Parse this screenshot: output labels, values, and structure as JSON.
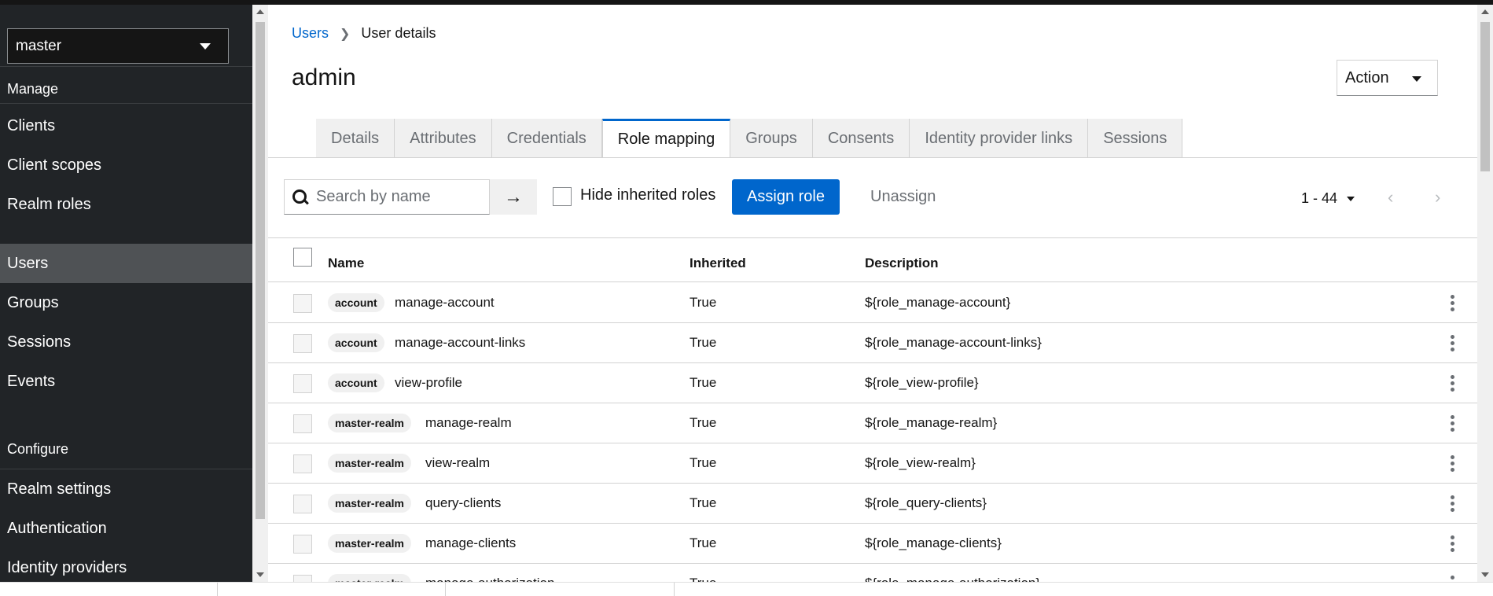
{
  "sidebar": {
    "realm": "master",
    "sections": [
      {
        "title": "Manage",
        "items": [
          "Clients",
          "Client scopes",
          "Realm roles",
          "Users",
          "Groups",
          "Sessions",
          "Events"
        ]
      },
      {
        "title": "Configure",
        "items": [
          "Realm settings",
          "Authentication",
          "Identity providers"
        ]
      }
    ]
  },
  "breadcrumb": {
    "parent": "Users",
    "current": "User details"
  },
  "page": {
    "title": "admin",
    "action_label": "Action"
  },
  "tabs": [
    "Details",
    "Attributes",
    "Credentials",
    "Role mapping",
    "Groups",
    "Consents",
    "Identity provider links",
    "Sessions"
  ],
  "toolbar": {
    "search_placeholder": "Search by name",
    "hide_inherited_label": "Hide inherited roles",
    "assign_label": "Assign role",
    "unassign_label": "Unassign",
    "pagination": "1 - 44"
  },
  "table": {
    "headers": {
      "name": "Name",
      "inherited": "Inherited",
      "description": "Description"
    },
    "rows": [
      {
        "client": "account",
        "role": "manage-account",
        "inherited": "True",
        "description": "${role_manage-account}"
      },
      {
        "client": "account",
        "role": "manage-account-links",
        "inherited": "True",
        "description": "${role_manage-account-links}"
      },
      {
        "client": "account",
        "role": "view-profile",
        "inherited": "True",
        "description": "${role_view-profile}"
      },
      {
        "client": "master-realm",
        "role": "manage-realm",
        "inherited": "True",
        "description": "${role_manage-realm}"
      },
      {
        "client": "master-realm",
        "role": "view-realm",
        "inherited": "True",
        "description": "${role_view-realm}"
      },
      {
        "client": "master-realm",
        "role": "query-clients",
        "inherited": "True",
        "description": "${role_query-clients}"
      },
      {
        "client": "master-realm",
        "role": "manage-clients",
        "inherited": "True",
        "description": "${role_manage-clients}"
      },
      {
        "client": "master-realm",
        "role": "manage-authorization",
        "inherited": "True",
        "description": "${role_manage-authorization}"
      }
    ]
  },
  "colors": {
    "accent": "#0066cc",
    "sidebar_bg": "#212427",
    "sidebar_active": "#4f5255"
  }
}
